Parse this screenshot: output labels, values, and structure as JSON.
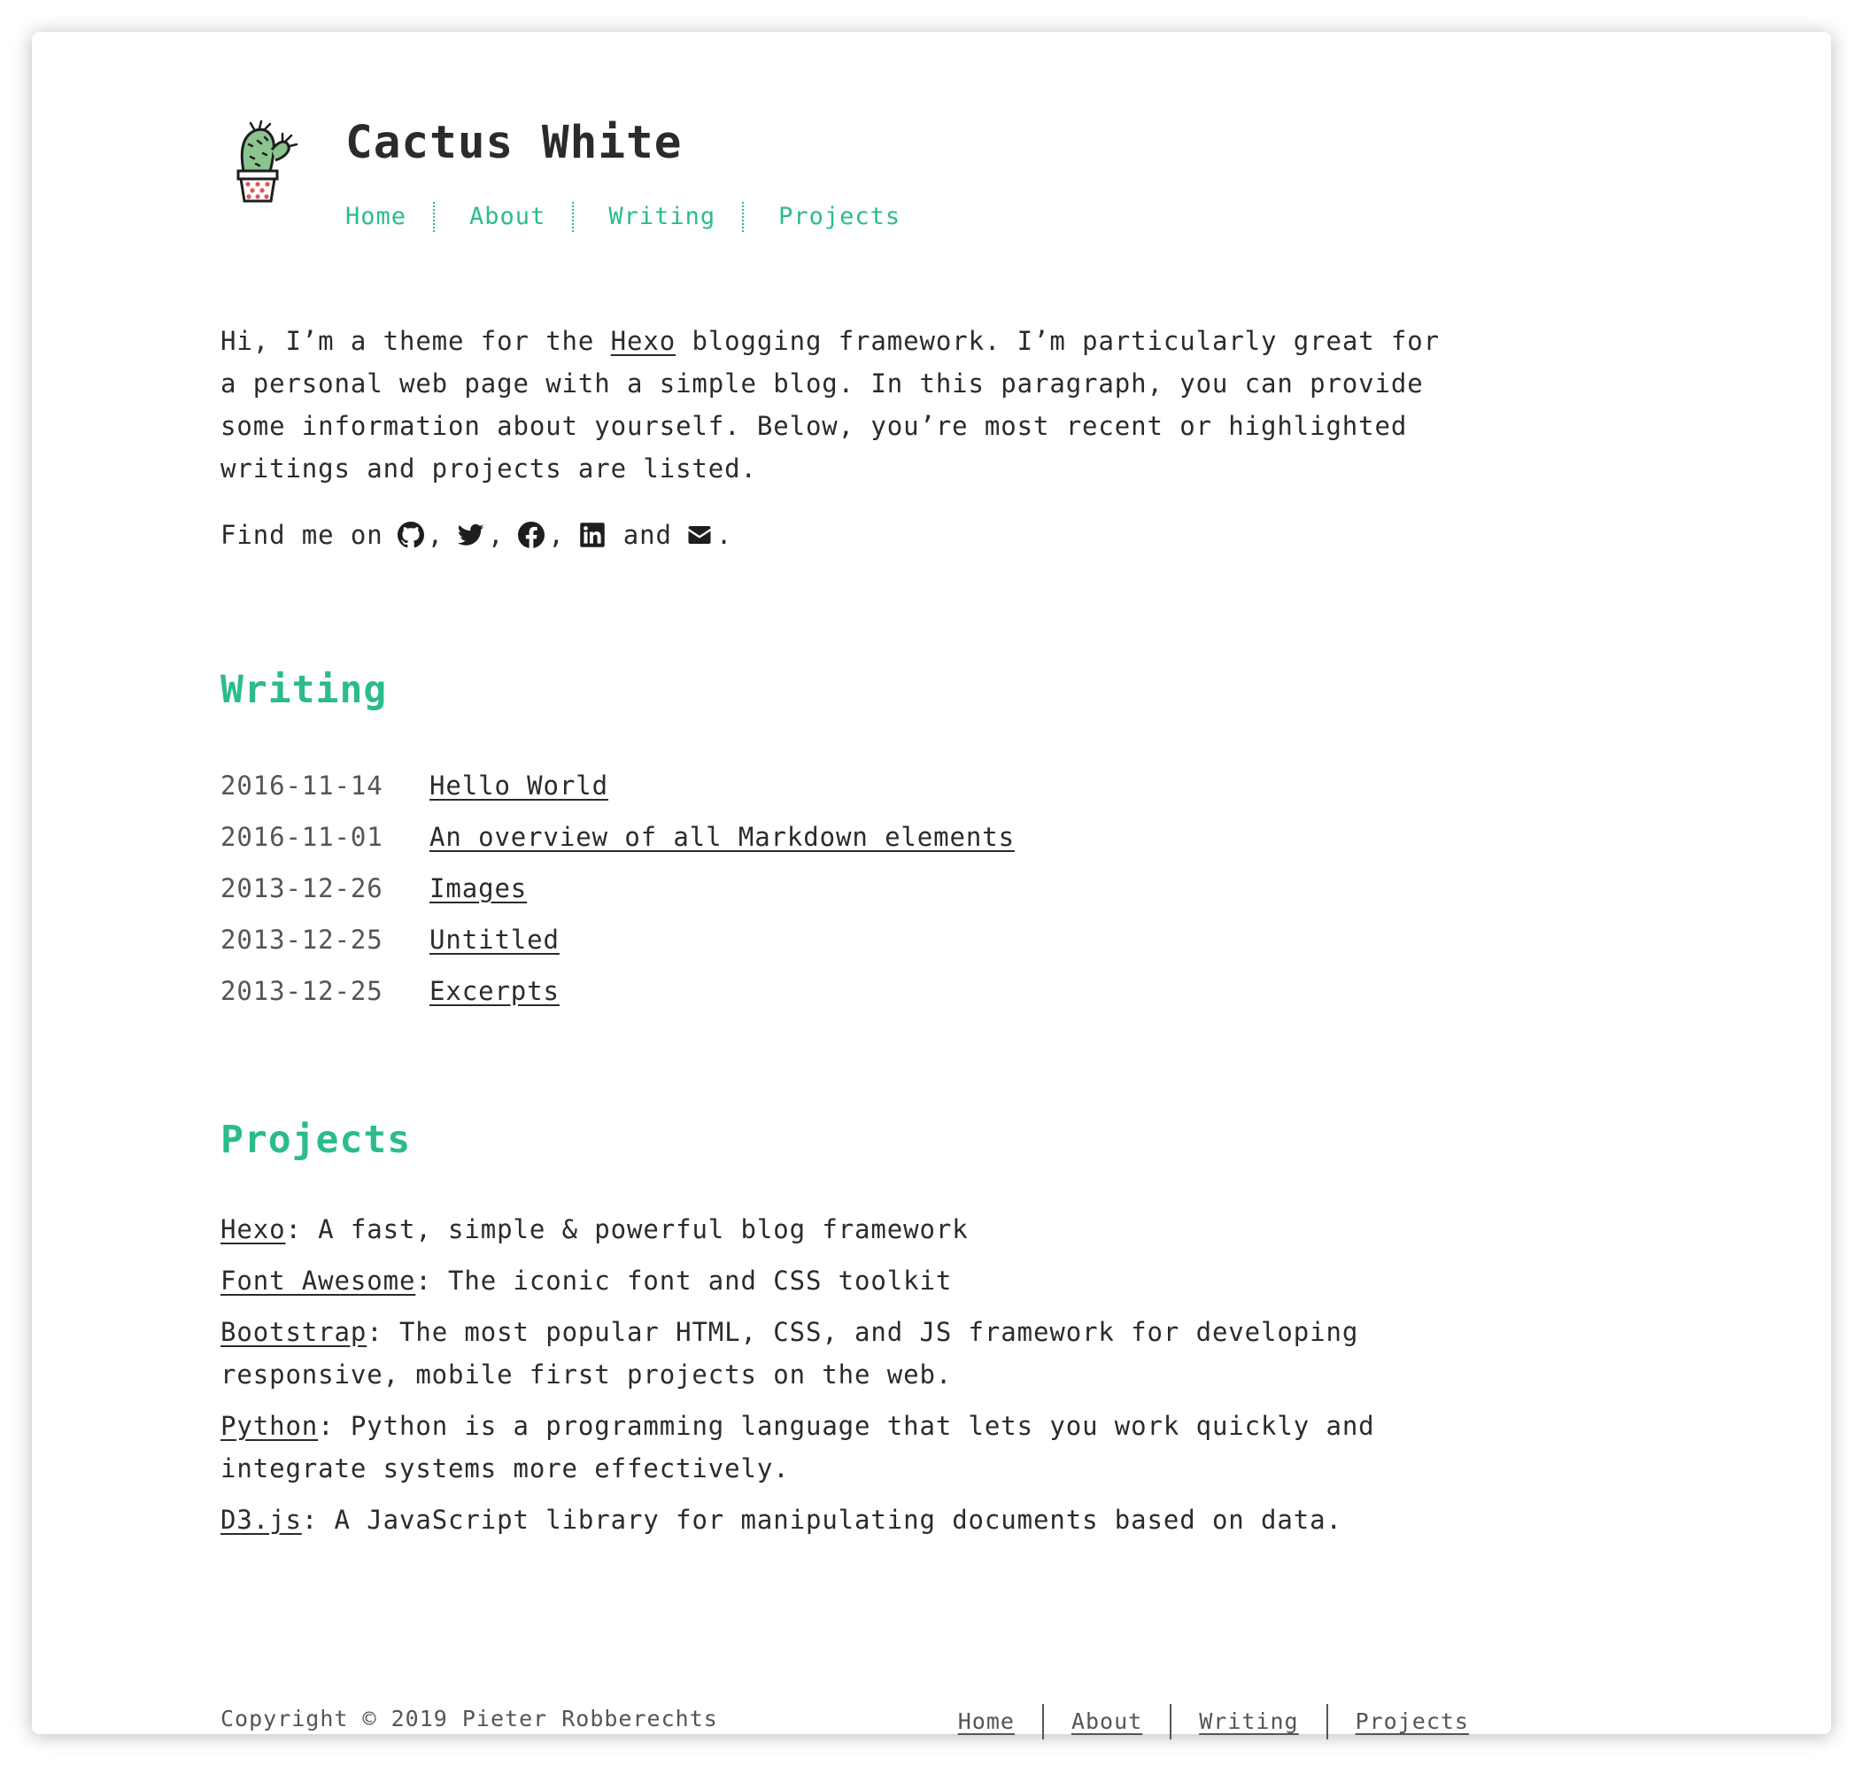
{
  "site": {
    "title": "Cactus White",
    "logo_icon": "cactus-logo-icon"
  },
  "nav": {
    "home": "Home",
    "about": "About",
    "writing": "Writing",
    "projects": "Projects"
  },
  "intro": {
    "before_link": "Hi, I’m a theme for the ",
    "link": "Hexo",
    "after_link": " blogging framework. I’m particularly great for a per­sonal web page with a simple blog. In this paragraph, you can provide some informa­tion about yourself. Below, you’re most recent or highlighted writings and projects are listed.",
    "find_me": "Find me on",
    "comma": ",",
    "and": "and",
    "period": ".",
    "social_icons": [
      "github-icon",
      "twitter-icon",
      "facebook-icon",
      "linkedin-icon",
      "envelope-icon"
    ]
  },
  "writing": {
    "title": "Writing",
    "posts": [
      {
        "date": "2016-11-14",
        "title": "Hello World"
      },
      {
        "date": "2016-11-01",
        "title": "An overview of all Markdown elements"
      },
      {
        "date": "2013-12-26",
        "title": "Images"
      },
      {
        "date": "2013-12-25",
        "title": "Untitled"
      },
      {
        "date": "2013-12-25",
        "title": "Excerpts"
      }
    ]
  },
  "projects": {
    "title": "Projects",
    "items": [
      {
        "name": "Hexo",
        "desc": ": A fast, simple & powerful blog framework"
      },
      {
        "name": "Font Awesome",
        "desc": ": The iconic font and CSS toolkit"
      },
      {
        "name": "Bootstrap",
        "desc": ": The most popular HTML, CSS, and JS framework for developing responsive, mobile first projects on the web."
      },
      {
        "name": "Python",
        "desc": ": Python is a programming language that lets you work quickly and integrate systems more effectively."
      },
      {
        "name": "D3.js",
        "desc": ": A JavaScript library for manipulating documents based on data."
      }
    ]
  },
  "footer": {
    "copyright": "Copyright © 2019 Pieter Robberechts",
    "nav": {
      "home": "Home",
      "about": "About",
      "writing": "Writing",
      "projects": "Projects"
    }
  },
  "colors": {
    "accent": "#2bbc8a",
    "text": "#2b2b2b",
    "muted": "#555555"
  }
}
